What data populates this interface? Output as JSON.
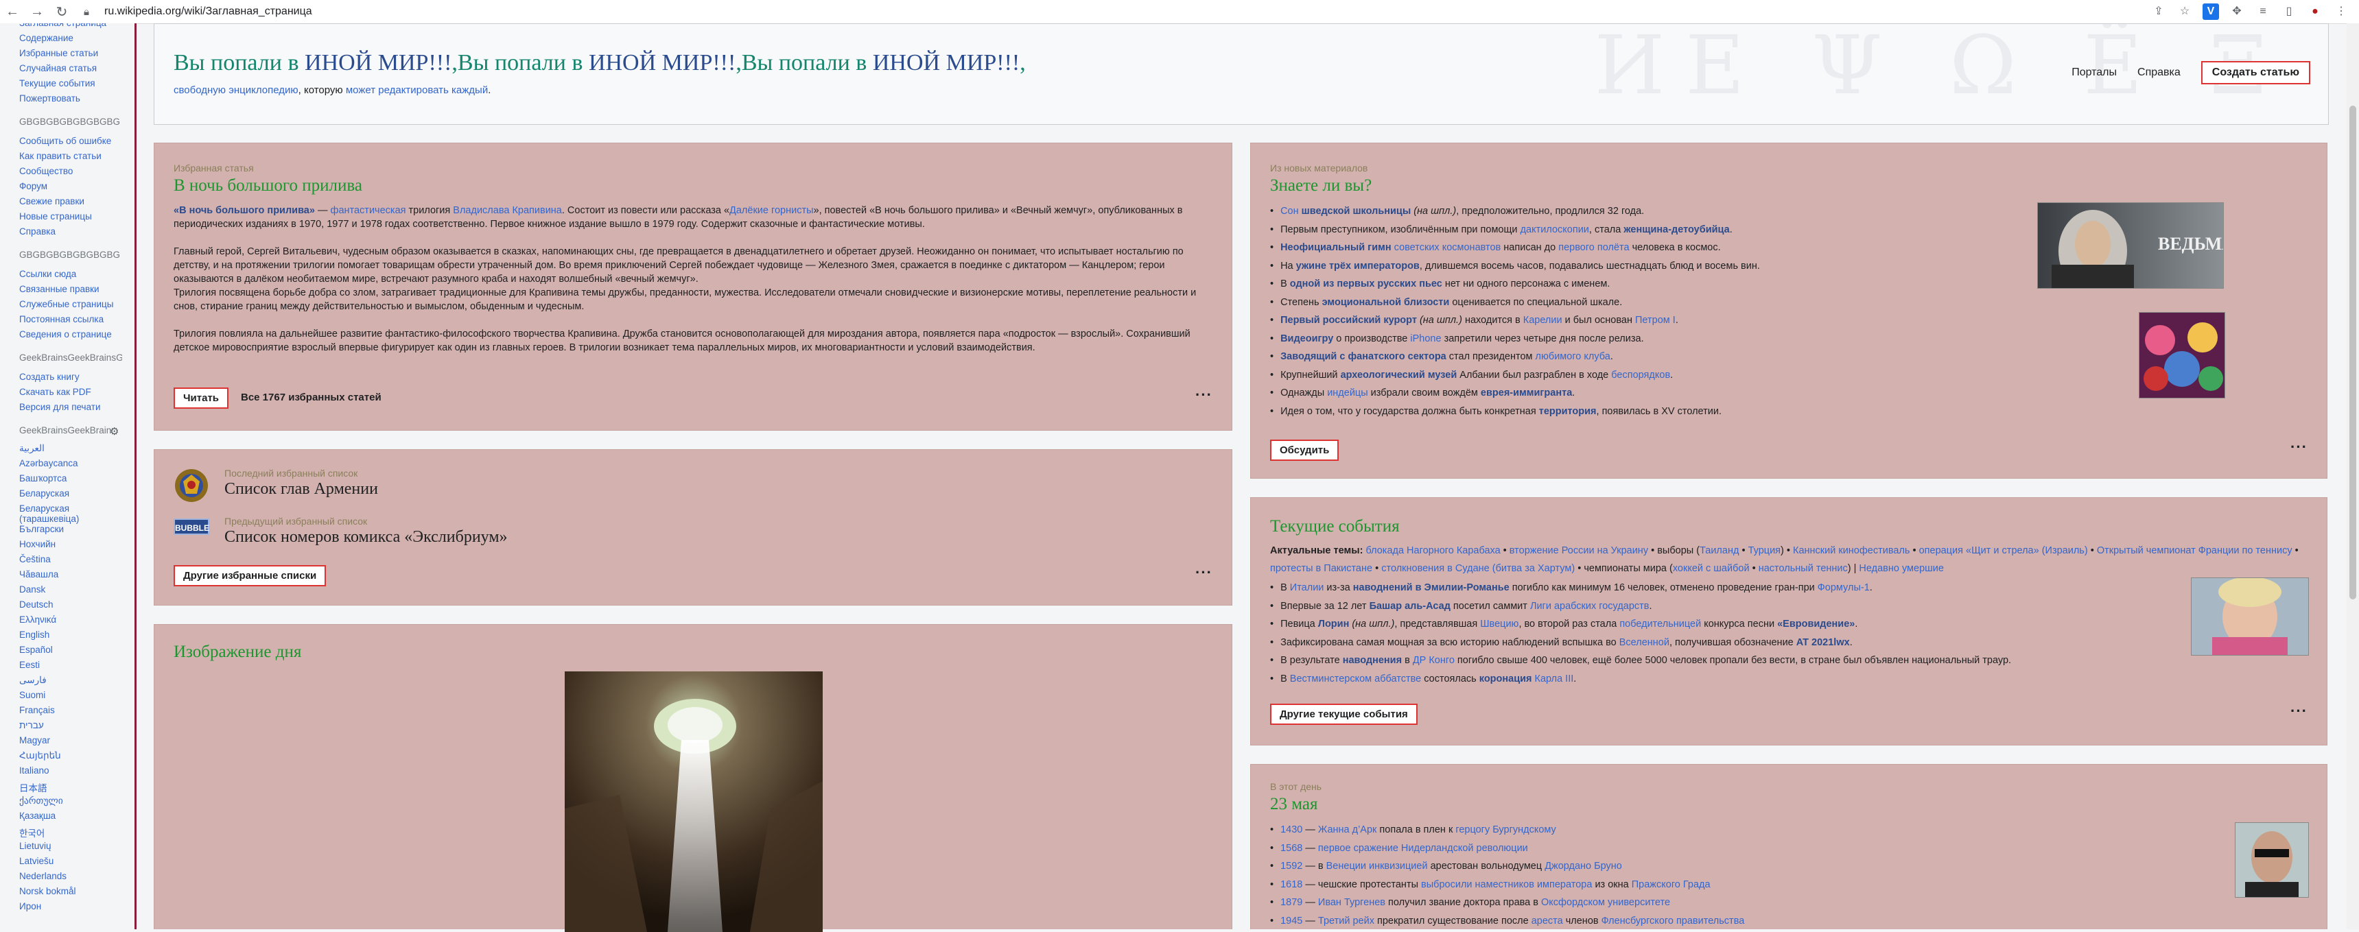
{
  "browser": {
    "url": "ru.wikipedia.org/wiki/Заглавная_страница"
  },
  "sidebar": {
    "nav": [
      "Заглавная страница",
      "Содержание",
      "Избранные статьи",
      "Случайная статья",
      "Текущие события",
      "Пожертвовать"
    ],
    "group1_head": "GBGBGBGBGBGBGBG",
    "group1": [
      "Сообщить об ошибке",
      "Как править статьи",
      "Сообщество",
      "Форум",
      "Свежие правки",
      "Новые страницы",
      "Справка"
    ],
    "group2_head": "GBGBGBGBGBGBGBG",
    "group2": [
      "Ссылки сюда",
      "Связанные правки",
      "Служебные страницы",
      "Постоянная ссылка",
      "Сведения о странице"
    ],
    "group3_head": "GeekBrainsGeekBrainsG",
    "group3": [
      "Создать книгу",
      "Скачать как PDF",
      "Версия для печати"
    ],
    "group4_head": "GeekBrainsGeekBrainsG",
    "languages": [
      "العربية",
      "Azərbaycanca",
      "Башҡортса",
      "Беларуская",
      "Беларуская (тарашкевіца)",
      "Български",
      "Нохчийн",
      "Čeština",
      "Чӑвашла",
      "Dansk",
      "Deutsch",
      "Ελληνικά",
      "English",
      "Español",
      "Eesti",
      "فارسی",
      "Suomi",
      "Français",
      "עברית",
      "Magyar",
      "Հայերեն",
      "Italiano",
      "日本語",
      "ქართული",
      "Қазақша",
      "한국어",
      "Lietuvių",
      "Latviešu",
      "Nederlands",
      "Norsk bokmål",
      "Ирон"
    ]
  },
  "header": {
    "welcome_parts": [
      {
        "text": "Вы попали в ",
        "style": "g"
      },
      {
        "text": "ИНОЙ МИР!!!",
        "style": "b"
      },
      {
        "text": ",",
        "style": "g"
      },
      {
        "text": "Вы попали в ",
        "style": "g"
      },
      {
        "text": "ИНОЙ МИР!!!",
        "style": "b"
      },
      {
        "text": ",",
        "style": "g"
      },
      {
        "text": "Вы попали в ",
        "style": "g"
      },
      {
        "text": "ИНОЙ МИР!!!",
        "style": "b"
      },
      {
        "text": ",",
        "style": "g"
      }
    ],
    "sub_link1": "свободную энциклопедию",
    "sub_text": ", которую ",
    "sub_link2": "может редактировать каждый",
    "sub_end": ".",
    "portals": "Порталы",
    "help": "Справка",
    "create": "Создать статью",
    "watermark": "ИЕ Ψ Ω Ё Ξ"
  },
  "featured": {
    "kicker": "Избранная статья",
    "title": "В ночь большого прилива",
    "p1_bold": "«В ночь большого прилива»",
    "p1_a": " — ",
    "p1_link1": "фантастическая",
    "p1_b": " трилогия ",
    "p1_link2": "Владислава Крапивина",
    "p1_c": ". Состоит из повести или рассказа «",
    "p1_link3": "Далёкие горнисты",
    "p1_d": "», повестей «В ночь большого прилива» и «Вечный жемчуг», опубликованных в периодических изданиях в 1970, 1977 и 1978 годах соответственно. Первое книжное издание вышло в 1979 году. Содержит сказочные и фантастические мотивы.",
    "p2": "Главный герой, Сергей Витальевич, чудесным образом оказывается в сказках, напоминающих сны, где превращается в двенадцатилетнего и обретает друзей. Неожиданно он понимает, что испытывает ностальгию по детству, и на протяжении трилогии помогает товарищам обрести утраченный дом. Во время приключений Сергей побеждает чудовище — Железного Змея, сражается в поединке с диктатором — Канцлером; герои оказываются в далёком необитаемом мире, встречают разумного краба и находят волшебный «вечный жемчуг».",
    "p3": "Трилогия посвящена борьбе добра со злом, затрагивает традиционные для Крапивина темы дружбы, преданности, мужества. Исследователи отмечали сновидческие и визионерские мотивы, переплетение реальности и снов, стирание границ между действительностью и вымыслом, обыденным и чудесным.",
    "p4": "Трилогия повлияла на дальнейшее развитие фантастико-философского творчества Крапивина. Дружба становится основополагающей для мироздания автора, появляется пара «подросток — взрослый». Сохранивший детское мировосприятие взрослый впервые фигурирует как один из главных героев. В трилогии возникает тема параллельных миров, их многовариантности и условий взаимодействия.",
    "read": "Читать",
    "all": "Все 1767 избранных статей"
  },
  "lists": {
    "k1": "Последний избранный список",
    "t1": "Список глав Армении",
    "k2": "Предыдущий избранный список",
    "t2": "Список номеров комикса «Экслибриум»",
    "badge": "BUBBLE",
    "button": "Другие избранные списки"
  },
  "picture": {
    "title": "Изображение дня"
  },
  "dyk": {
    "kicker": "Из новых материалов",
    "title": "Знаете ли вы?",
    "items": [
      [
        [
          "a",
          "Сон "
        ],
        [
          "bl",
          "шведской школьницы"
        ],
        [
          "i",
          " (на шпл.)"
        ],
        [
          "t",
          ", предположительно, продлился 32 года."
        ]
      ],
      [
        [
          "t",
          "Первым преступником, изобличённым при помощи "
        ],
        [
          "a",
          "дактилоскопии"
        ],
        [
          "t",
          ", стала "
        ],
        [
          "bl",
          "женщина-детоубийца"
        ],
        [
          "t",
          "."
        ]
      ],
      [
        [
          "bl",
          "Неофициальный гимн"
        ],
        [
          "a",
          " советских космонавтов"
        ],
        [
          "t",
          " написан до "
        ],
        [
          "a",
          "первого полёта"
        ],
        [
          "t",
          " человека в космос."
        ]
      ],
      [
        [
          "t",
          "На "
        ],
        [
          "bl",
          "ужине трёх императоров"
        ],
        [
          "t",
          ", длившемся восемь часов, подавались шестнадцать блюд и восемь вин."
        ]
      ],
      [
        [
          "t",
          "В "
        ],
        [
          "bl",
          "одной из первых русских пьес"
        ],
        [
          "t",
          " нет ни одного персонажа с именем."
        ]
      ],
      [
        [
          "t",
          "Степень "
        ],
        [
          "bl",
          "эмоциональной близости"
        ],
        [
          "t",
          " оценивается по специальной шкале."
        ]
      ],
      [
        [
          "bl",
          "Первый российский курорт"
        ],
        [
          "i",
          " (на шпл.)"
        ],
        [
          "t",
          " находится в "
        ],
        [
          "a",
          "Карелии"
        ],
        [
          "t",
          " и был основан "
        ],
        [
          "a",
          "Петром I"
        ],
        [
          "t",
          "."
        ]
      ],
      [
        [
          "bl",
          "Видеоигру"
        ],
        [
          "t",
          " о производстве "
        ],
        [
          "a",
          "iPhone"
        ],
        [
          "t",
          " запретили через четыре дня после релиза."
        ]
      ],
      [
        [
          "bl",
          "Заводящий с фанатского сектора"
        ],
        [
          "t",
          " стал президентом "
        ],
        [
          "a",
          "любимого клуба"
        ],
        [
          "t",
          "."
        ]
      ],
      [
        [
          "t",
          "Крупнейший "
        ],
        [
          "bl",
          "археологический музей"
        ],
        [
          "t",
          " Албании был разграблен в ходе "
        ],
        [
          "a",
          "беспорядков"
        ],
        [
          "t",
          "."
        ]
      ],
      [
        [
          "t",
          "Однажды "
        ],
        [
          "a",
          "индейцы"
        ],
        [
          "t",
          " избрали своим вождём "
        ],
        [
          "bl",
          "еврея-иммигранта"
        ],
        [
          "t",
          "."
        ]
      ],
      [
        [
          "t",
          "Идея о том, что у государства должна быть конкретная "
        ],
        [
          "bl",
          "территория"
        ],
        [
          "t",
          ", появилась в XV столетии."
        ]
      ]
    ],
    "button": "Обсудить",
    "witcher_text": "ВЕДЬМАК"
  },
  "news": {
    "title": "Текущие события",
    "topics_label": "Актуальные темы:",
    "topics": [
      [
        "a",
        "блокада Нагорного Карабаха"
      ],
      [
        "t",
        " • "
      ],
      [
        "a",
        "вторжение России на Украину"
      ],
      [
        "t",
        " • выборы ("
      ],
      [
        "a",
        "Таиланд"
      ],
      [
        "t",
        " • "
      ],
      [
        "a",
        "Турция"
      ],
      [
        "t",
        ") • "
      ],
      [
        "a",
        "Каннский кинофестиваль"
      ],
      [
        "t",
        " • "
      ],
      [
        "a",
        "операция «Щит и стрела» (Израиль)"
      ],
      [
        "t",
        " • "
      ],
      [
        "a",
        "Открытый чемпионат Франции по теннису"
      ],
      [
        "t",
        " • "
      ],
      [
        "a",
        "протесты в Пакистане"
      ],
      [
        "t",
        " • "
      ],
      [
        "a",
        "столкновения в Судане (битва за Хартум)"
      ],
      [
        "t",
        " • чемпионаты мира ("
      ],
      [
        "a",
        "хоккей с шайбой"
      ],
      [
        "t",
        " • "
      ],
      [
        "a",
        "настольный теннис"
      ],
      [
        "t",
        ") | "
      ],
      [
        "a",
        "Недавно умершие"
      ]
    ],
    "items": [
      [
        [
          "t",
          "В "
        ],
        [
          "a",
          "Италии"
        ],
        [
          "t",
          " из-за "
        ],
        [
          "bl",
          "наводнений в Эмилии-Романье"
        ],
        [
          "t",
          " погибло как минимум 16 человек, отменено проведение гран-при "
        ],
        [
          "a",
          "Формулы-1"
        ],
        [
          "t",
          "."
        ]
      ],
      [
        [
          "t",
          "Впервые за 12 лет "
        ],
        [
          "bl",
          "Башар аль-Асад"
        ],
        [
          "t",
          " посетил саммит "
        ],
        [
          "a",
          "Лиги арабских государств"
        ],
        [
          "t",
          "."
        ]
      ],
      [
        [
          "t",
          "Певица "
        ],
        [
          "bl",
          "Лорин"
        ],
        [
          "i",
          " (на шпл.)"
        ],
        [
          "t",
          ", представлявшая "
        ],
        [
          "a",
          "Швецию"
        ],
        [
          "t",
          ", во второй раз стала "
        ],
        [
          "a",
          "победительницей"
        ],
        [
          "t",
          " конкурса песни "
        ],
        [
          "bl",
          "«Евровидение»"
        ],
        [
          "t",
          "."
        ]
      ],
      [
        [
          "t",
          "Зафиксирована самая мощная за всю историю наблюдений вспышка во "
        ],
        [
          "a",
          "Вселенной"
        ],
        [
          "t",
          ", получившая обозначение "
        ],
        [
          "bl",
          "AT 2021lwx"
        ],
        [
          "t",
          "."
        ]
      ],
      [
        [
          "t",
          "В результате "
        ],
        [
          "bl",
          "наводнения"
        ],
        [
          "t",
          " в "
        ],
        [
          "a",
          "ДР Конго"
        ],
        [
          "t",
          " погибло свыше 400 человек, ещё более 5000 человек пропали без вести, в стране был объявлен национальный траур."
        ]
      ],
      [
        [
          "t",
          "В "
        ],
        [
          "a",
          "Вестминстерском аббатстве"
        ],
        [
          "t",
          " состоялась "
        ],
        [
          "bl",
          "коронация"
        ],
        [
          "t",
          " "
        ],
        [
          "a",
          "Карла III"
        ],
        [
          "t",
          "."
        ]
      ]
    ],
    "button": "Другие текущие события"
  },
  "onthisday": {
    "kicker": "В этот день",
    "date": "23 мая",
    "items": [
      [
        [
          "a",
          "1430"
        ],
        [
          "t",
          " — "
        ],
        [
          "a",
          "Жанна д’Арк"
        ],
        [
          "t",
          " попала в плен к "
        ],
        [
          "a",
          "герцогу Бургундскому"
        ]
      ],
      [
        [
          "a",
          "1568"
        ],
        [
          "t",
          " — "
        ],
        [
          "a",
          "первое сражение Нидерландской революции"
        ]
      ],
      [
        [
          "a",
          "1592"
        ],
        [
          "t",
          " — в "
        ],
        [
          "a",
          "Венеции инквизицией"
        ],
        [
          "t",
          " арестован вольнодумец "
        ],
        [
          "a",
          "Джордано Бруно"
        ]
      ],
      [
        [
          "a",
          "1618"
        ],
        [
          "t",
          " — чешские протестанты "
        ],
        [
          "a",
          "выбросили наместников императора"
        ],
        [
          "t",
          " из окна "
        ],
        [
          "a",
          "Пражского Града"
        ]
      ],
      [
        [
          "a",
          "1879"
        ],
        [
          "t",
          " — "
        ],
        [
          "a",
          "Иван Тургенев"
        ],
        [
          "t",
          " получил звание доктора права в "
        ],
        [
          "a",
          "Оксфордском университете"
        ]
      ],
      [
        [
          "a",
          "1945"
        ],
        [
          "t",
          " — "
        ],
        [
          "a",
          "Третий рейх"
        ],
        [
          "t",
          " прекратил существование после "
        ],
        [
          "a",
          "ареста"
        ],
        [
          "t",
          " членов "
        ],
        [
          "a",
          "Фленсбургского правительства"
        ]
      ]
    ]
  },
  "colors": {
    "box": "#d3b1af",
    "title_green": "#1e9630",
    "link": "#3366cc",
    "button_border": "#dd3333"
  },
  "icons": [
    "back-icon",
    "forward-icon",
    "reload-icon",
    "share-icon",
    "star-icon",
    "extension-v-icon",
    "puzzle-icon",
    "playlist-icon",
    "sidebar-icon",
    "profile-icon",
    "menu-icon",
    "gear-icon"
  ]
}
